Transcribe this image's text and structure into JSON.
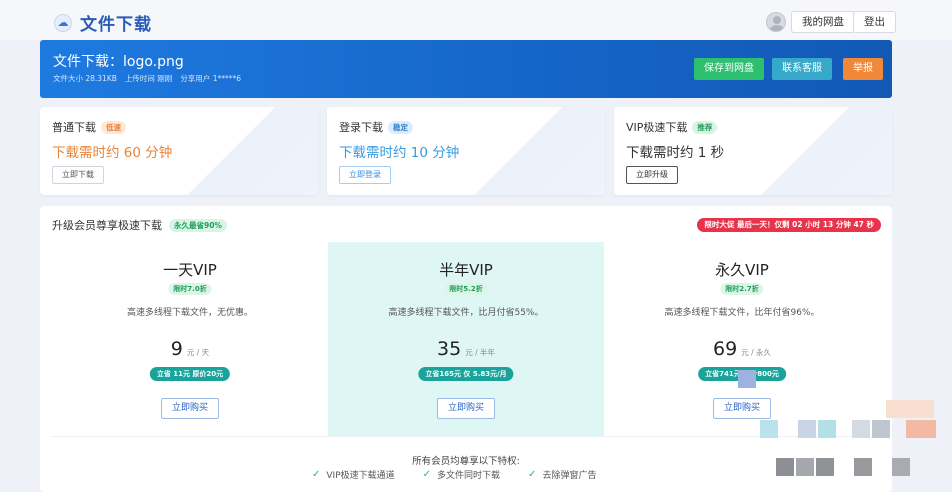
{
  "header": {
    "site_title": "文件下载",
    "my_drive": "我的网盘",
    "logout": "登出"
  },
  "file": {
    "title": "文件下载：logo.png",
    "size_label": "文件大小 28.31KB",
    "upload_label": "上传时间 刚刚",
    "share_label": "分享用户 1*****6",
    "save_btn": "保存到网盘",
    "contact_btn": "联系客服",
    "report_btn": "举报"
  },
  "download_options": [
    {
      "name": "普通下载",
      "tag": "低速",
      "time": "下载需时约 60 分钟",
      "button": "立即下载"
    },
    {
      "name": "登录下载",
      "tag": "稳定",
      "time": "下载需时约 10 分钟",
      "button": "立即登录"
    },
    {
      "name": "VIP极速下载",
      "tag": "推荐",
      "time": "下载需时约 1 秒",
      "button": "立即升级"
    }
  ],
  "vip": {
    "title": "升级会员尊享极速下载",
    "title_tag": "永久最省90%",
    "countdown": "限时大促 最后一天！仅剩 02 小时 13 分钟 47 秒",
    "plans": [
      {
        "name": "一天VIP",
        "discount": "限时7.0折",
        "desc": "高速多线程下载文件，无优惠。",
        "price": "9",
        "unit": "元 / 天",
        "save": "立省 11元 原价20元",
        "buy": "立即购买"
      },
      {
        "name": "半年VIP",
        "discount": "限时5.2折",
        "desc": "高速多线程下载文件，比月付省55%。",
        "price": "35",
        "unit": "元 / 半年",
        "save": "立省165元 仅 5.83元/月",
        "buy": "立即购买"
      },
      {
        "name": "永久VIP",
        "discount": "限时2.7折",
        "desc": "高速多线程下载文件，比年付省96%。",
        "price": "69",
        "unit": "元 / 永久",
        "save": "立省741元 原价800元",
        "buy": "立即购买"
      }
    ],
    "perks_title": "所有会员均尊享以下特权:",
    "perks": [
      "VIP极速下载通道",
      "多文件同时下载",
      "去除弹窗广告"
    ]
  },
  "colors": {
    "primary_blue": "#1f7ae0",
    "save_green": "#2bbf6f",
    "contact_teal": "#36a8c9",
    "report_orange": "#f0883a",
    "slow_orange": "#e8833a",
    "login_blue": "#3a9be0",
    "countdown_red": "#e8334b",
    "plan_teal": "#1aa39a"
  }
}
